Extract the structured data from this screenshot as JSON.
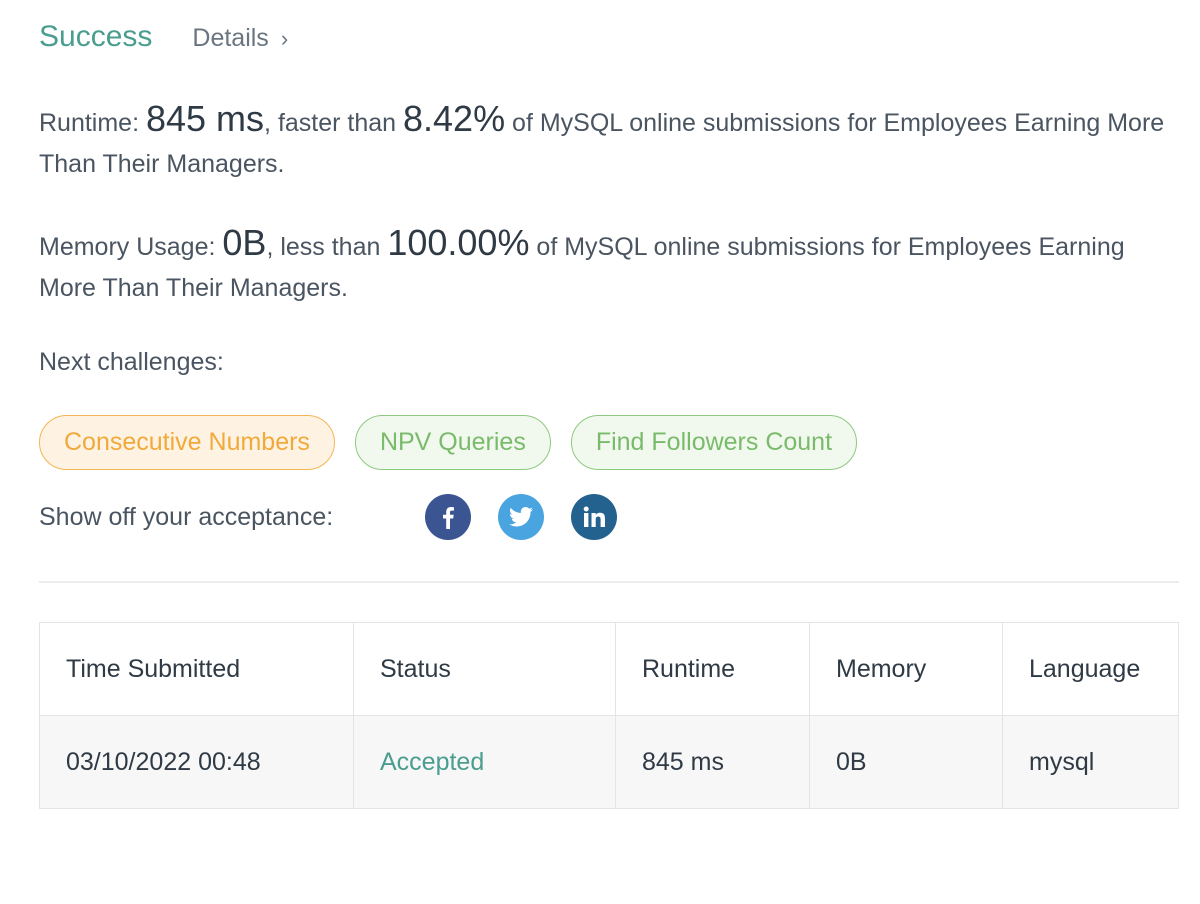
{
  "header": {
    "status_title": "Success",
    "details_label": "Details",
    "chevron_glyph": "›"
  },
  "runtime_stat": {
    "label": "Runtime: ",
    "value": "845 ms",
    "mid_text": ", faster than ",
    "percent": "8.42%",
    "tail_text": " of MySQL online submissions for Employees Earning More Than Their Managers."
  },
  "memory_stat": {
    "label": "Memory Usage: ",
    "value": "0B",
    "mid_text": ", less than ",
    "percent": "100.00%",
    "tail_text": " of MySQL online submissions for Employees Earning More Than Their Managers."
  },
  "next_challenges": {
    "label": "Next challenges:",
    "items": [
      {
        "label": "Consecutive Numbers",
        "difficulty": "medium"
      },
      {
        "label": "NPV Queries",
        "difficulty": "easy"
      },
      {
        "label": "Find Followers Count",
        "difficulty": "easy"
      }
    ]
  },
  "share": {
    "label": "Show off your acceptance:",
    "icons": [
      "facebook-icon",
      "twitter-icon",
      "linkedin-icon"
    ]
  },
  "submissions": {
    "headers": [
      "Time Submitted",
      "Status",
      "Runtime",
      "Memory",
      "Language"
    ],
    "rows": [
      [
        "03/10/2022 00:48",
        "Accepted",
        "845 ms",
        "0B",
        "mysql"
      ]
    ]
  },
  "colors": {
    "success": "#4a9d8f",
    "medium_chip": "#f0a93a",
    "easy_chip": "#7abb6b",
    "facebook": "#3b5592",
    "twitter": "#4aa4e0",
    "linkedin": "#23628f"
  }
}
